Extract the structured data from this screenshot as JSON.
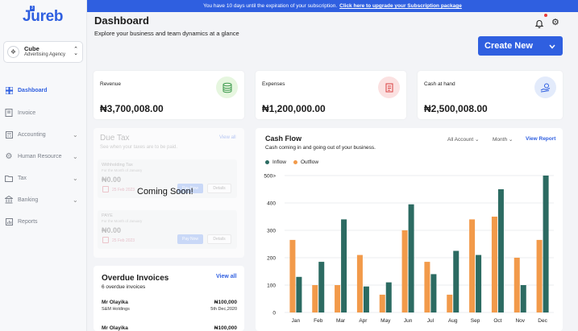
{
  "banner": {
    "text": "You have 10 days until the expiration of your subscription.",
    "link": "Click here to upgrade your Subscription package"
  },
  "brand": {
    "name": "Jureb"
  },
  "org": {
    "name": "Cube",
    "sub": "Advertising Agency",
    "avatar_icon": "cube-icon"
  },
  "sidebar": {
    "items": [
      {
        "label": "Dashboard",
        "icon": "dashboard-icon",
        "active": true,
        "caret": false
      },
      {
        "label": "Invoice",
        "icon": "invoice-icon",
        "active": false,
        "caret": false
      },
      {
        "label": "Accounting",
        "icon": "calculator-icon",
        "active": false,
        "caret": true
      },
      {
        "label": "Human Resource",
        "icon": "gear-icon",
        "active": false,
        "caret": true
      },
      {
        "label": "Tax",
        "icon": "folder-icon",
        "active": false,
        "caret": true
      },
      {
        "label": "Banking",
        "icon": "bank-icon",
        "active": false,
        "caret": true
      },
      {
        "label": "Reports",
        "icon": "reports-icon",
        "active": false,
        "caret": false
      }
    ]
  },
  "header": {
    "title": "Dashboard",
    "subtitle": "Explore your business and team dynamics at a glance",
    "create_label": "Create New"
  },
  "stats": [
    {
      "label": "Revenue",
      "value": "₦3,700,008.00",
      "icon": "coins-icon",
      "color": "#e6f6df"
    },
    {
      "label": "Expenses",
      "value": "₦1,200,000.00",
      "icon": "receipt-icon",
      "color": "#fbe1e1"
    },
    {
      "label": "Cash at hand",
      "value": "₦2,500,008.00",
      "icon": "cash-hand-icon",
      "color": "#e3ebfb"
    }
  ],
  "due_tax": {
    "title": "Due Tax",
    "view_all": "View all",
    "subtitle": "See when your taxes are to be paid.",
    "overlay": "Coming Soon!",
    "items": [
      {
        "name": "Withholding Tax",
        "period": "For the Month of January",
        "amount": "₦0.00",
        "date": "25 Feb 2023",
        "pay": "Pay Now",
        "details": "Details"
      },
      {
        "name": "PAYE",
        "period": "For the Month of January",
        "amount": "₦0.00",
        "date": "25 Feb 2023",
        "pay": "Pay Now",
        "details": "Details"
      }
    ]
  },
  "overdue": {
    "title": "Overdue Invoices",
    "view_all": "View all",
    "count": "6 overdue invoices",
    "rows": [
      {
        "name": "Mr Olayika",
        "company": "S&M Holdings",
        "amount": "₦100,000",
        "date": "5th Dec,2020"
      },
      {
        "name": "Mr Olayika",
        "company": "",
        "amount": "₦100,000",
        "date": ""
      }
    ]
  },
  "cash_flow": {
    "title": "Cash Flow",
    "subtitle": "Cash coming in and going out of your business.",
    "filter_account": "All Account",
    "filter_period": "Month",
    "view_report": "View Report"
  },
  "colors": {
    "accent": "#2f5fe0",
    "inflow": "#2c6b62",
    "outflow": "#f29a4a"
  },
  "chart_data": {
    "type": "bar",
    "categories": [
      "Jan",
      "Feb",
      "Mar",
      "Apr",
      "May",
      "Jun",
      "Jul",
      "Aug",
      "Sep",
      "Oct",
      "Nov",
      "Dec"
    ],
    "series": [
      {
        "name": "Inflow",
        "color": "#2c6b62",
        "values": [
          130,
          185,
          340,
          95,
          110,
          395,
          140,
          225,
          210,
          450,
          100,
          500
        ]
      },
      {
        "name": "Outflow",
        "color": "#f29a4a",
        "values": [
          265,
          100,
          100,
          210,
          65,
          300,
          185,
          65,
          340,
          350,
          200,
          265
        ]
      }
    ],
    "yticks": [
      "0",
      "100",
      "200",
      "300",
      "400",
      "500>"
    ],
    "ylim": [
      0,
      500
    ],
    "grid": true,
    "legend": "top-left"
  }
}
